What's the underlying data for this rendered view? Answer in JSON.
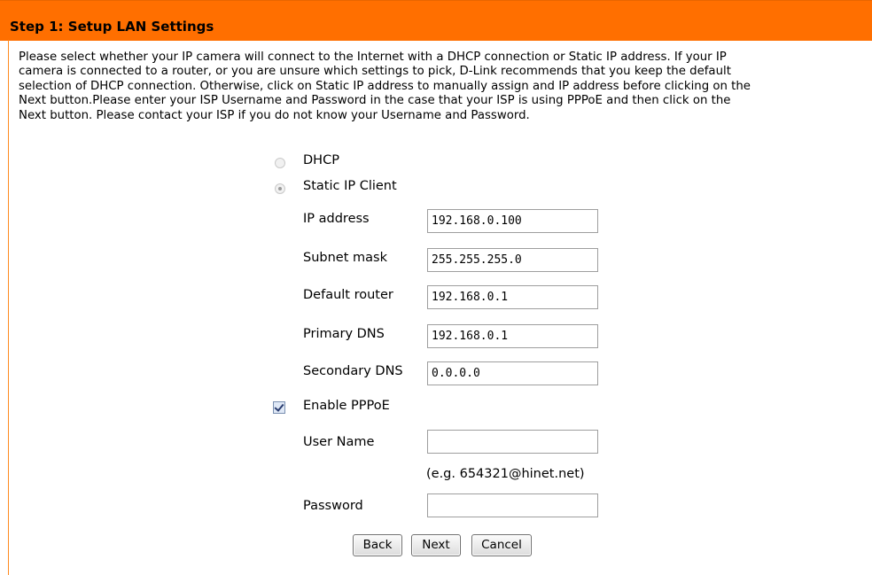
{
  "header": {
    "title": "Step 1: Setup LAN Settings"
  },
  "description": {
    "lines": [
      "Please select whether your IP camera will connect to the Internet with a DHCP connection or Static IP address. If your IP",
      "camera is connected to a router, or you are unsure which settings to pick, D-Link recommends that you keep the default",
      "selection of DHCP connection. Otherwise, click on Static IP address to manually assign and IP address before clicking on the",
      "Next button.Please enter your ISP Username and Password in the case that your ISP is using PPPoE and then click on the",
      "Next button. Please contact your ISP if you do not know your Username and Password."
    ]
  },
  "connection": {
    "dhcp_label": "DHCP",
    "static_label": "Static IP Client",
    "selected": "Static IP Client"
  },
  "static_ip": {
    "ip_address_label": "IP address",
    "ip_address_value": "192.168.0.100",
    "subnet_mask_label": "Subnet mask",
    "subnet_mask_value": "255.255.255.0",
    "default_router_label": "Default router",
    "default_router_value": "192.168.0.1",
    "primary_dns_label": "Primary DNS",
    "primary_dns_value": "192.168.0.1",
    "secondary_dns_label": "Secondary DNS",
    "secondary_dns_value": "0.0.0.0"
  },
  "pppoe": {
    "enable_label": "Enable PPPoE",
    "enabled": true,
    "username_label": "User Name",
    "username_value": "",
    "username_hint": "(e.g. 654321@hinet.net)",
    "password_label": "Password",
    "password_value": ""
  },
  "buttons": {
    "back_label": "Back",
    "next_label": "Next",
    "cancel_label": "Cancel"
  }
}
